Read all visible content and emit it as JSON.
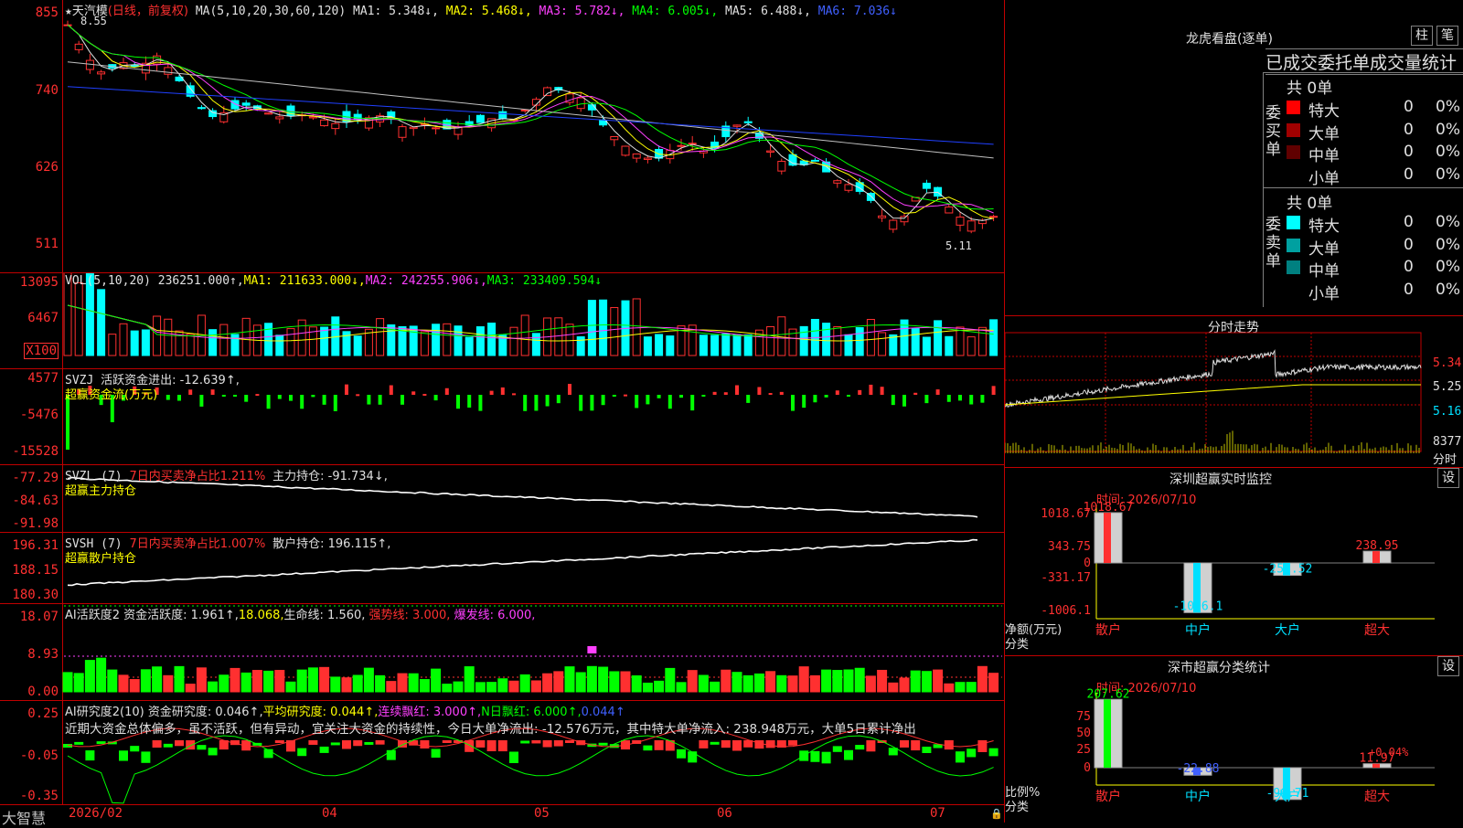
{
  "main": {
    "title_line": {
      "star": "★",
      "name": "天汽模",
      "mode": "(日线，前复权)",
      "ma_label": "MA(5,10,20,30,60,120)",
      "ma1": "MA1: 5.348↓,",
      "ma2": "MA2: 5.468↓,",
      "ma3": "MA3: 5.782↓,",
      "ma4": "MA4: 6.005↓,",
      "ma5": "MA5: 6.488↓,",
      "ma6": "MA6: 7.036↓"
    },
    "y_labels": [
      "855",
      "740",
      "626",
      "511"
    ],
    "high_mark": "8.55",
    "low_mark": "5.11"
  },
  "vol": {
    "legend": {
      "label": "VOL(5,10,20)",
      "value": "236251.000↑,",
      "ma1": "MA1: 211633.000↓,",
      "ma2": "MA2: 242255.906↓,",
      "ma3": "MA3: 233409.594↓"
    },
    "y_labels": [
      "13095",
      "6467"
    ],
    "unit": "X100"
  },
  "svzj": {
    "legend": {
      "label": "SVZJ",
      "text": "活跃资金进出: -12.639↑,",
      "sub": "超赢资金流(万元)"
    },
    "y_labels": [
      "4577",
      "-5476",
      "-15528"
    ]
  },
  "svzl": {
    "legend": {
      "label": "SVZL (7)",
      "text": "7日内买卖净占比1.211%",
      "main": "主力持仓: -91.734↓,",
      "sub": "超赢主力持仓"
    },
    "y_labels": [
      "-77.29",
      "-84.63",
      "-91.98"
    ]
  },
  "svsh": {
    "legend": {
      "label": "SVSH (7)",
      "text": "7日内买卖净占比1.007%",
      "main": "散户持仓: 196.115↑,",
      "sub": "超赢散户持仓"
    },
    "y_labels": [
      "196.31",
      "188.15",
      "180.30"
    ]
  },
  "ai1": {
    "legend": {
      "label": "AI活跃度2",
      "a": "资金活跃度: 1.961↑,",
      "b": "18.068,",
      "c": "生命线: 1.560,",
      "d": "强势线: 3.000,",
      "e": "爆发线: 6.000,"
    },
    "y_labels": [
      "18.07",
      "8.93",
      "0.00"
    ]
  },
  "ai2": {
    "legend": {
      "label": "AI研究度2(10)",
      "a": "资金研究度: 0.046↑,",
      "b": "平均研究度: 0.044↑,",
      "c": "连续飘红: 3.000↑,",
      "d": "N日飘红: 6.000↑,",
      "e": "0.044↑"
    },
    "note": "近期大资金总体偏多，虽不活跃，但有异动，宜关注大资金的持续性，今日大单净流出: -12.576万元，其中特大单净流入: 238.948万元，大单5日累计净出",
    "y_labels": [
      "0.25",
      "-0.05",
      "-0.35"
    ]
  },
  "xaxis": {
    "brand": "大智慧",
    "labels": [
      "2026/02",
      "04",
      "05",
      "06",
      "07"
    ]
  },
  "right": {
    "dragon_title": "龙虎看盘(逐单)",
    "btn_zhu": "柱",
    "btn_bi": "笔",
    "tabs_text": "已成交委托单成交量统计",
    "buy": {
      "side": "委买单",
      "total": "共 0单",
      "rows": [
        {
          "name": "特大",
          "v": "0",
          "p": "0%",
          "color": "#ff0000"
        },
        {
          "name": "大单",
          "v": "0",
          "p": "0%",
          "color": "#a00000"
        },
        {
          "name": "中单",
          "v": "0",
          "p": "0%",
          "color": "#600000"
        },
        {
          "name": "小单",
          "v": "0",
          "p": "0%",
          "color": "#000000"
        }
      ]
    },
    "sell": {
      "side": "委卖单",
      "total": "共 0单",
      "rows": [
        {
          "name": "特大",
          "v": "0",
          "p": "0%",
          "color": "#00ffff"
        },
        {
          "name": "大单",
          "v": "0",
          "p": "0%",
          "color": "#00a0a0"
        },
        {
          "name": "中单",
          "v": "0",
          "p": "0%",
          "color": "#008080"
        },
        {
          "name": "小单",
          "v": "0",
          "p": "0%",
          "color": "#000000"
        }
      ]
    },
    "intraday": {
      "title": "分时走势",
      "y_labels": [
        "5.34",
        "5.25",
        "5.16"
      ],
      "vol_label": "8377",
      "unit": "分时"
    },
    "sz_monitor": {
      "title": "深圳超赢实时监控",
      "btn": "设",
      "time": "时间: 2026/07/10",
      "y_labels": [
        "1018.67",
        "343.75",
        "0",
        "-331.17",
        "-1006.1"
      ],
      "ylabel": "净额(万元)",
      "xlabel": "分类",
      "bars": [
        {
          "cat": "散户",
          "value": "1018.67",
          "color": "#ff3030"
        },
        {
          "cat": "中户",
          "value": "-1006.1",
          "color": "#00e0ff"
        },
        {
          "cat": "大户",
          "value": "-251.52",
          "color": "#00e0ff"
        },
        {
          "cat": "超大",
          "value": "238.95",
          "color": "#ff3030"
        }
      ]
    },
    "sz_class": {
      "title": "深市超赢分类统计",
      "btn": "设",
      "time": "时间: 2026/07/10",
      "y_labels": [
        "75",
        "50",
        "25",
        "0"
      ],
      "ylabel": "比例%",
      "xlabel": "分类",
      "bars": [
        {
          "cat": "散户",
          "value": "207.62",
          "color": "#00ff00"
        },
        {
          "cat": "中户",
          "value": "-22.88",
          "color": "#4060ff"
        },
        {
          "cat": "大户",
          "value": "-96.71",
          "color": "#00e0ff"
        },
        {
          "cat": "超大",
          "value": "11.97",
          "color": "#ff3030"
        }
      ],
      "note": "+0.04%"
    }
  }
}
